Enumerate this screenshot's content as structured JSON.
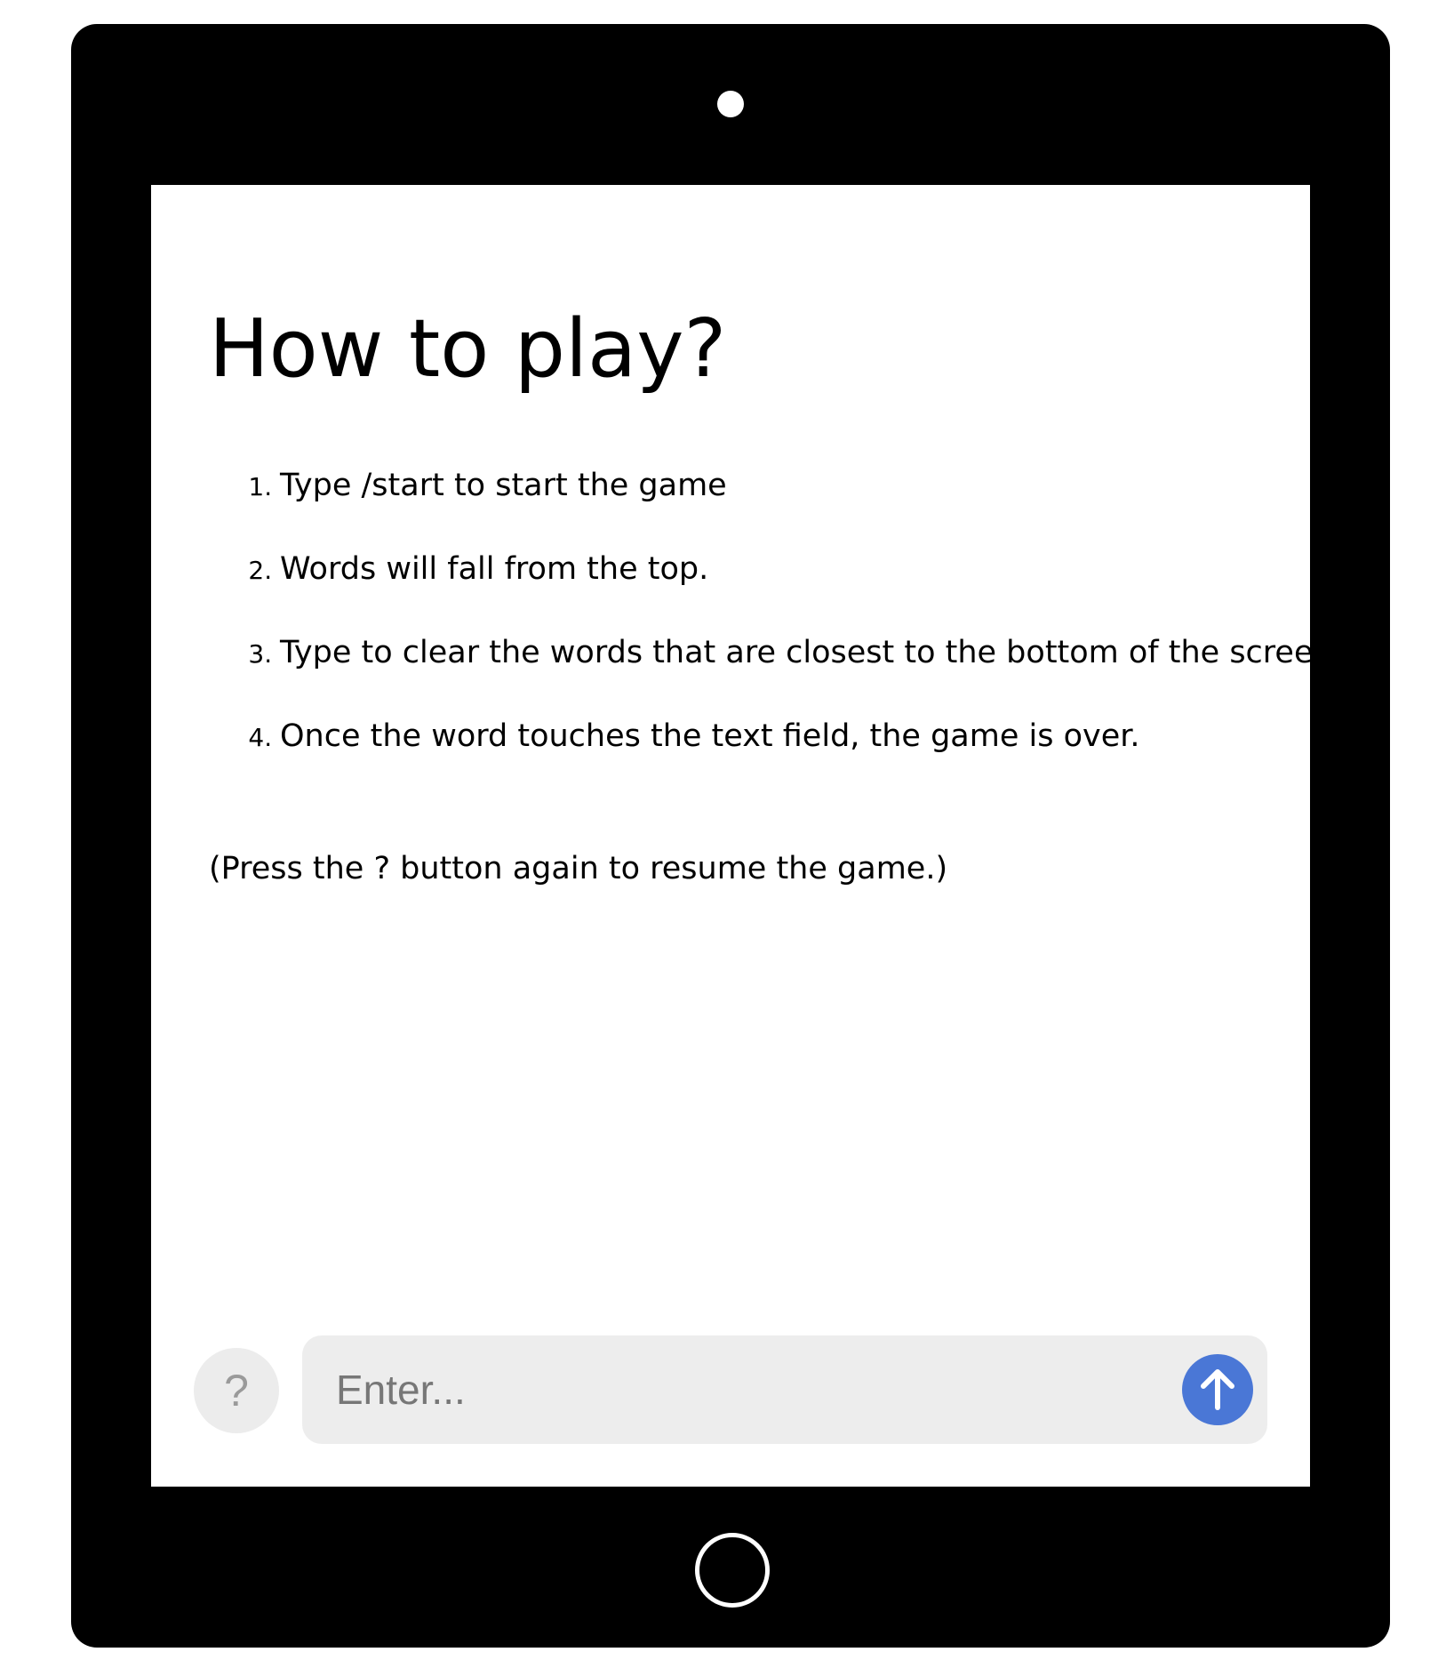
{
  "screen": {
    "title": "How to play?",
    "steps": [
      "Type /start to start the game",
      "Words will fall from the top.",
      "Type to clear the words that are closest to the bottom of the screen.",
      "Once the word touches the text field, the game is over."
    ],
    "note": "(Press the ? button again to resume the game.)"
  },
  "composer": {
    "help_label": "?",
    "placeholder": "Enter...",
    "send_icon": "arrow-up-icon"
  },
  "colors": {
    "bezel": "#000000",
    "accent": "#4a77d6",
    "field_background": "#ededed"
  }
}
